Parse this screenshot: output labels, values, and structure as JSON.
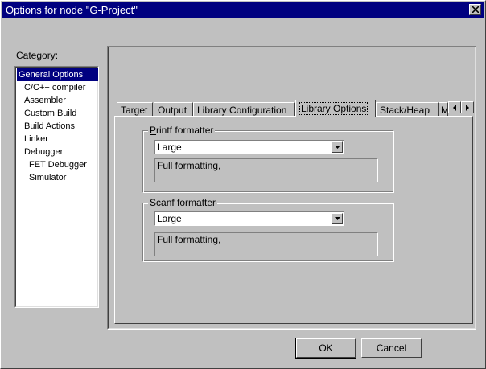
{
  "window": {
    "title": "Options for node \"G-Project\""
  },
  "category": {
    "label": "Category:",
    "items": [
      {
        "label": "General Options"
      },
      {
        "label": "C/C++ compiler"
      },
      {
        "label": "Assembler"
      },
      {
        "label": "Custom Build"
      },
      {
        "label": "Build Actions"
      },
      {
        "label": "Linker"
      },
      {
        "label": "Debugger"
      },
      {
        "label": "FET Debugger"
      },
      {
        "label": "Simulator"
      }
    ]
  },
  "tabs": [
    {
      "label": "Target"
    },
    {
      "label": "Output"
    },
    {
      "label": "Library Configuration"
    },
    {
      "label": "Library Options"
    },
    {
      "label": "Stack/Heap"
    },
    {
      "label": "M"
    }
  ],
  "printf": {
    "label_first": "P",
    "label_rest": "rintf formatter",
    "value": "Large",
    "description": "Full formatting,"
  },
  "scanf": {
    "label_first": "S",
    "label_rest": "canf formatter",
    "value": "Large",
    "description": "Full formatting,"
  },
  "buttons": {
    "ok": "OK",
    "cancel": "Cancel"
  }
}
